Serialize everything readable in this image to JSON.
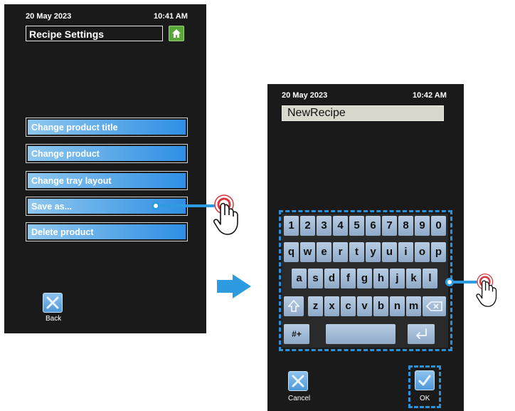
{
  "left_screen": {
    "date": "20 May 2023",
    "time": "10:41 AM",
    "title": "Recipe Settings",
    "menu": [
      {
        "label": "Change product title"
      },
      {
        "label": "Change product"
      },
      {
        "label": "Change tray layout"
      },
      {
        "label": "Save as..."
      },
      {
        "label": "Delete product"
      }
    ],
    "back_label": "Back"
  },
  "right_screen": {
    "date": "20 May 2023",
    "time": "10:42 AM",
    "input_value": "NewRecipe",
    "keyboard": {
      "row1": [
        "1",
        "2",
        "3",
        "4",
        "5",
        "6",
        "7",
        "8",
        "9",
        "0"
      ],
      "row2": [
        "q",
        "w",
        "e",
        "r",
        "t",
        "y",
        "u",
        "i",
        "o",
        "p"
      ],
      "row3": [
        "a",
        "s",
        "d",
        "f",
        "g",
        "h",
        "j",
        "k",
        "l"
      ],
      "row4": [
        "z",
        "x",
        "c",
        "v",
        "b",
        "n",
        "m"
      ],
      "symbols_label": "#+"
    },
    "cancel_label": "Cancel",
    "ok_label": "OK"
  },
  "colors": {
    "screen_bg": "#1a1a1a",
    "accent_blue": "#2e9be0",
    "home_green": "#5aa83a",
    "pointer_red": "#d8343b"
  },
  "icons": [
    "home-icon",
    "close-x-icon",
    "checkmark-icon",
    "shift-icon",
    "backspace-icon",
    "enter-icon",
    "pointing-hand-icon",
    "tap-target-icon"
  ]
}
